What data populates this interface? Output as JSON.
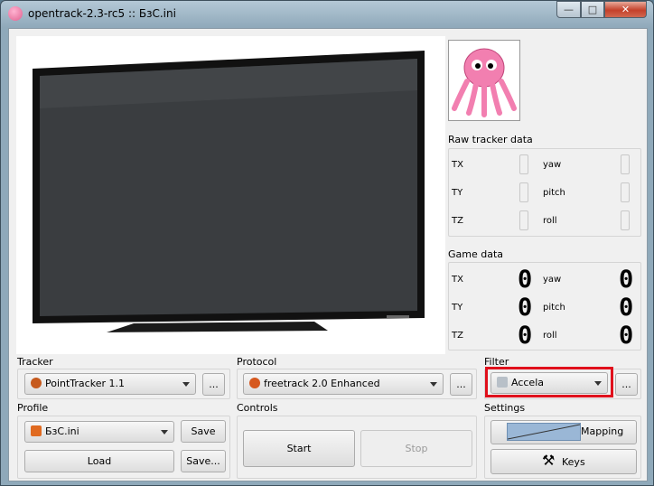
{
  "window": {
    "title": "opentrack-2.3-rc5 :: БзС.ini",
    "min": "—",
    "max": "□",
    "close": "✕"
  },
  "sections": {
    "raw": "Raw tracker data",
    "game": "Game data",
    "tracker": "Tracker",
    "protocol": "Protocol",
    "filter": "Filter",
    "profile": "Profile",
    "controls": "Controls",
    "settings": "Settings"
  },
  "axes": {
    "tx": "TX",
    "ty": "TY",
    "tz": "TZ",
    "yaw": "yaw",
    "pitch": "pitch",
    "roll": "roll"
  },
  "game_values": {
    "tx": "0",
    "ty": "0",
    "tz": "0",
    "yaw": "0",
    "pitch": "0",
    "roll": "0"
  },
  "tracker": {
    "selected": "PointTracker 1.1",
    "more": "..."
  },
  "protocol": {
    "selected": "freetrack 2.0 Enhanced",
    "more": "..."
  },
  "filter": {
    "selected": "Accela",
    "more": "..."
  },
  "profile": {
    "selected": "БзС.ini",
    "save": "Save",
    "load": "Load",
    "save_as": "Save..."
  },
  "controls": {
    "start": "Start",
    "stop": "Stop"
  },
  "settings": {
    "mapping": "Mapping",
    "keys": "Keys"
  },
  "colors": {
    "highlight": "#e0101c"
  }
}
